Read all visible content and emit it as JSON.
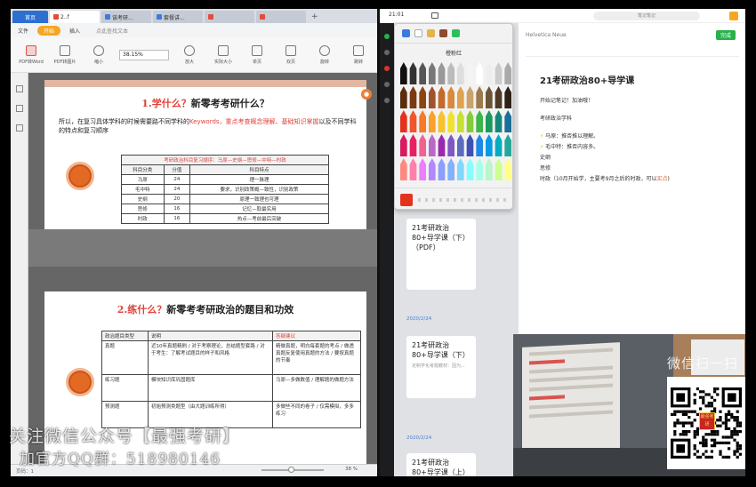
{
  "pdf_reader": {
    "tabs": [
      {
        "label": "首页",
        "type": "home"
      },
      {
        "label": "2..f",
        "type": "pdf"
      },
      {
        "label": "该考研...",
        "type": "doc"
      },
      {
        "label": "套餐讲...",
        "type": "doc"
      },
      {
        "label": "",
        "type": "pdf"
      },
      {
        "label": "",
        "type": "pdf"
      }
    ],
    "menu": {
      "file": "文件",
      "start": "开始",
      "insert": "插入",
      "search": "点此查找文本"
    },
    "toolbar": {
      "pdf_word": "PDF转Word",
      "pdf_image": "PDF转图片",
      "shrink": "缩小",
      "zoom_value": "38.15%",
      "enlarge": "放大",
      "actual_size": "实际大小",
      "single_page": "单页",
      "double_page": "双页",
      "rotate": "旋转",
      "jump": "跳转"
    },
    "page1": {
      "title_q": "1.学什么？",
      "title_rest": "新零考考研什么？",
      "intro_a": "所以，在复习具体学科的时候需要路不同学科的",
      "intro_keyword": "Keywords，重点考查概念理解、基础知识掌握",
      "intro_b": "以及不同学科的特点和复习顺序",
      "table_title": "考研政治科目复习顺序：马原—史纲—思修—中特—时政",
      "headers": [
        "科目分类",
        "分值",
        "科目特点"
      ],
      "rows": [
        [
          "马原",
          "24",
          "理一脉理"
        ],
        [
          "毛中特",
          "24",
          "要求，识别政策概—致性，识别政策"
        ],
        [
          "史纲",
          "20",
          "原理一致理也可理"
        ],
        [
          "思修",
          "16",
          "记忆—取最实用"
        ],
        [
          "时政",
          "16",
          "热点—考前最后突破"
        ]
      ]
    },
    "page2": {
      "title_q": "2.练什么？",
      "title_rest": "新零考考研政治的题目和功效",
      "headers": [
        "政治题目类型",
        "说明",
        "答疑建议"
      ],
      "rows": [
        [
          "真题",
          "近10年真题精刷 / 对于考察理论，总结题型套路 / 对于考生：了解考试题目的样子和风格",
          "精做真题，明白每套题的考点 / 做透真题反复使用真题的方法 / 要按真题的节奏"
        ],
        [
          "练习题",
          "模块知识库巩固题库",
          "马原—多做数值 / 理解题的做题方法"
        ],
        [
          "预测题",
          "初始预测类题型（由大题训练所得）",
          "多做些不同的卷子 / 仅需模拟，多多练习"
        ]
      ]
    },
    "status": {
      "page": "页码：1",
      "zoom": "38 %"
    }
  },
  "ipad": {
    "status_time": "21:01",
    "url": "笔记笔记",
    "picker": {
      "title": "橙粉红",
      "tab_colors": [
        "#3a7be0",
        "#ffffff",
        "#e6b24a",
        "#8c4a2f",
        "#2cbf5c"
      ],
      "current_color": "#e4321f"
    },
    "notes_list": [
      {
        "title": "21考研政治80+导学课（下）（PDF）",
        "snippet": ""
      },
      {
        "title": "21考研政治80+导学课（下）",
        "snippet": "定制学化考题教材：因为..."
      },
      {
        "title": "21考研政治80+导学课（上）（PDF）",
        "snippet": ""
      }
    ],
    "note_dates": [
      "2020/2/24",
      "2020/2/24"
    ],
    "editor": {
      "done_label": "完成",
      "toolbar_hint": "Helvetica Neue",
      "title": "21考研政治80+导学课",
      "lines": [
        {
          "text": "开始记笔记！加油哦！",
          "mark": ""
        },
        {
          "text": "考研政治学科",
          "mark": ""
        },
        {
          "text": "马原：推否推以理解。",
          "mark": "⚡"
        },
        {
          "text": "毛中特：推否内容多。",
          "mark": "⚡"
        },
        {
          "text": "史纲",
          "mark": ""
        },
        {
          "text": "思修",
          "mark": ""
        },
        {
          "text": "时政（10月开始学，主要考9月之后的时政，可以",
          "mark": "",
          "highlight": "买点"
        }
      ]
    }
  },
  "overlays": {
    "watermark_right": "微信扫一扫",
    "qr_badge": "最强考研",
    "watermark_left_1": "关注微信公众号【最强考研】",
    "watermark_left_2": "加官方QQ群：518980146"
  },
  "colors": {
    "accent_red": "#e0433a",
    "wps_blue": "#2d6fd1",
    "notes_green": "#27b24a",
    "orange_circle": "#e36a25"
  }
}
